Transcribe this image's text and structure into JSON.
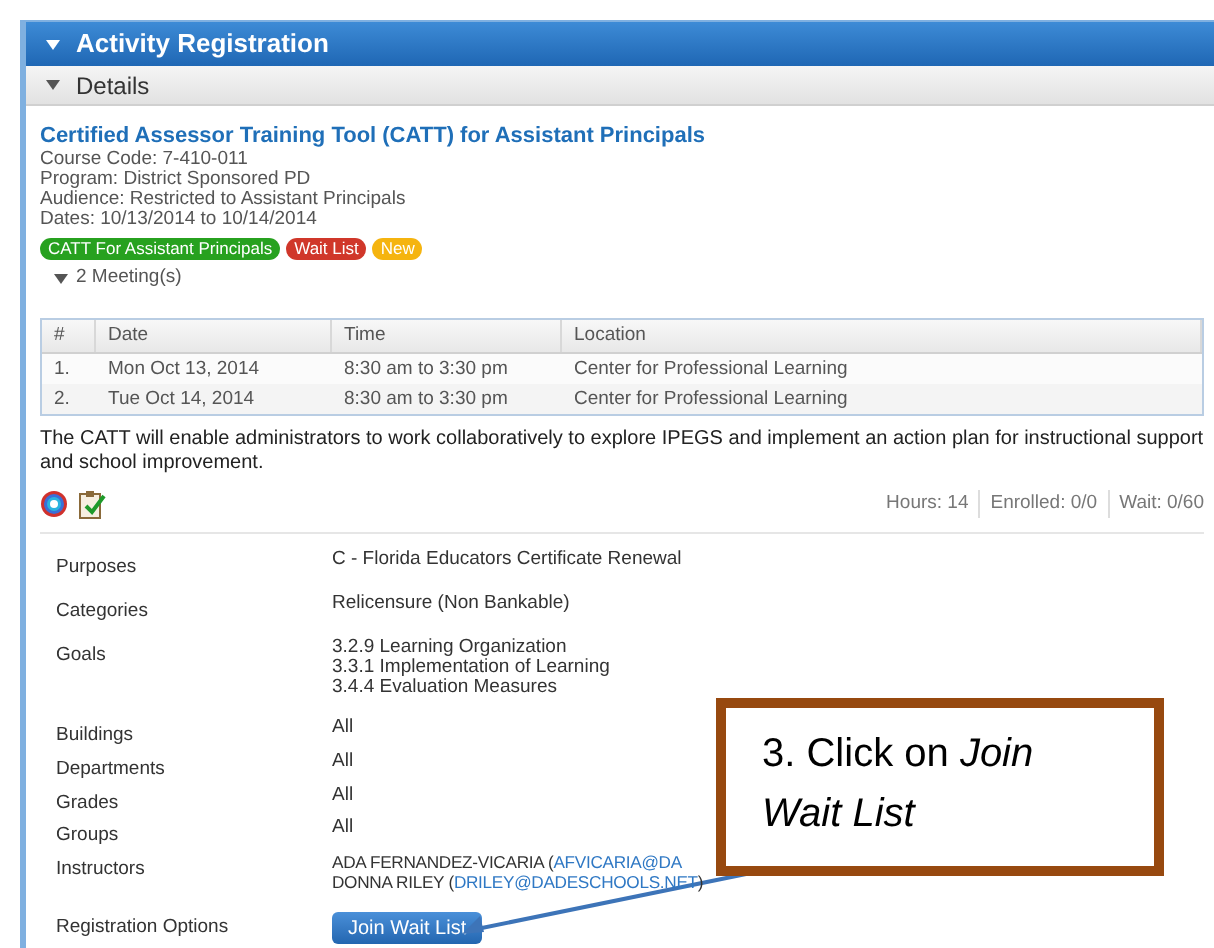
{
  "header": {
    "title": "Activity Registration"
  },
  "section": {
    "title": "Details",
    "expanded": true
  },
  "course": {
    "title": "Certified Assessor Training Tool (CATT) for Assistant Principals",
    "info": [
      "Course Code: 7-410-011",
      "Program: District Sponsored PD",
      "Audience: Restricted to Assistant Principals",
      "Dates: 10/13/2014 to 10/14/2014"
    ],
    "tags": [
      {
        "label": "CATT For Assistant Principals",
        "color": "#27a11f"
      },
      {
        "label": "Wait List",
        "color": "#d0372a"
      },
      {
        "label": "New",
        "color": "#f5b40f"
      }
    ],
    "meetings": {
      "label": "2 Meeting(s)",
      "expanded": true
    }
  },
  "table": {
    "columns": [
      "#",
      "Date",
      "Time",
      "Location"
    ],
    "rows": [
      [
        "1.",
        "Mon Oct 13, 2014",
        "8:30 am to 3:30 pm",
        "Center for Professional Learning"
      ],
      [
        "2.",
        "Tue Oct 14, 2014",
        "8:30 am to 3:30 pm",
        "Center for Professional Learning"
      ]
    ]
  },
  "description": "The CATT will enable administrators to work collaboratively to explore IPEGS and implement an action plan for instructional support and school improvement.",
  "stats": [
    "Hours: 14",
    "Enrolled: 0/0",
    "Wait: 0/60"
  ],
  "fields": [
    {
      "label": "Purposes",
      "values": [
        "C - Florida Educators Certificate Renewal"
      ]
    },
    {
      "label": "Categories",
      "values": [
        "Relicensure (Non Bankable)"
      ]
    },
    {
      "label": "Goals",
      "values": [
        "3.2.9 Learning Organization",
        "3.3.1 Implementation of Learning",
        "3.4.4 Evaluation Measures"
      ]
    },
    {
      "label": "Buildings",
      "values": [
        "All"
      ]
    },
    {
      "label": "Departments",
      "values": [
        "All"
      ]
    },
    {
      "label": "Grades",
      "values": [
        "All"
      ]
    },
    {
      "label": "Groups",
      "values": [
        "All"
      ]
    }
  ],
  "instructors": {
    "label": "Instructors",
    "people": [
      {
        "name": "ADA FERNANDEZ-VICARIA (",
        "email": "AFVICARIA@DA"
      },
      {
        "name": "DONNA RILEY (",
        "email": "DRILEY@DADESCHOOLS.NET",
        "close": ")"
      }
    ]
  },
  "registration": {
    "label": "Registration Options",
    "button": "Join Wait List"
  },
  "callout": {
    "lead": "3. Click on ",
    "emphasis": "Join Wait List"
  }
}
